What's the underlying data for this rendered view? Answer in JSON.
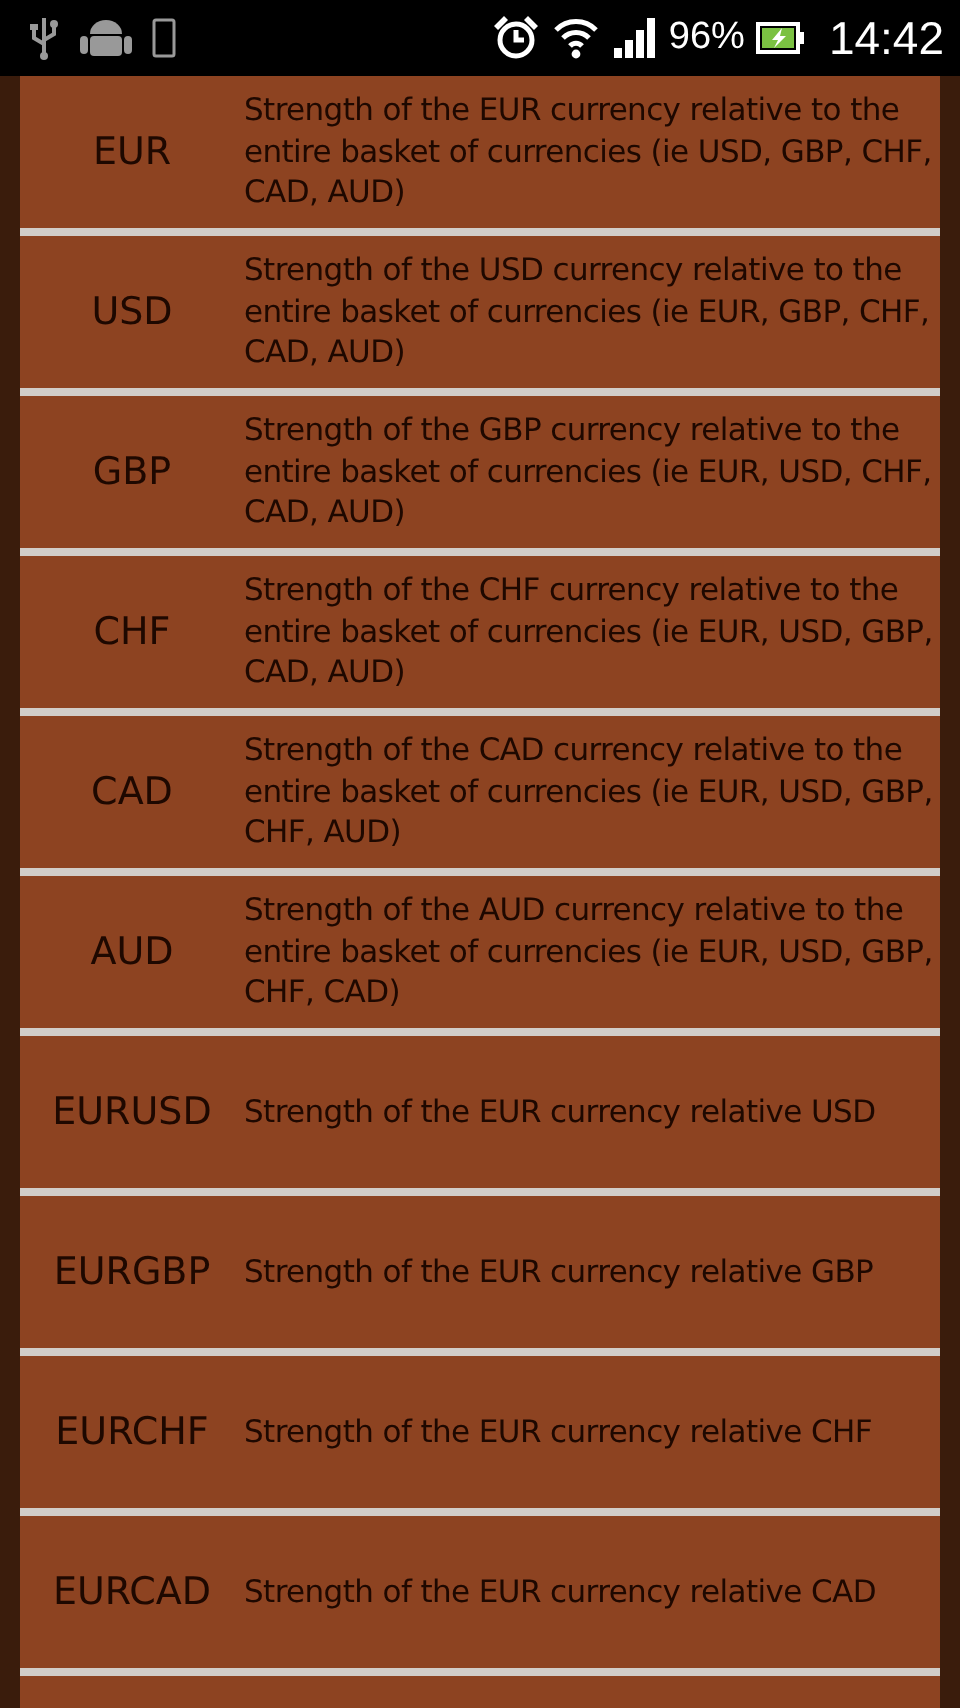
{
  "status_bar": {
    "battery_text": "96%",
    "time": "14:42"
  },
  "currencies": [
    {
      "code": "EUR",
      "description": "Strength of the EUR currency relative to the entire basket of currencies (ie USD, GBP, CHF, CAD, AUD)"
    },
    {
      "code": "USD",
      "description": "Strength of the USD currency relative to the entire basket of currencies (ie EUR, GBP, CHF, CAD, AUD)"
    },
    {
      "code": "GBP",
      "description": "Strength of the GBP currency relative to the entire basket of currencies (ie EUR, USD, CHF, CAD, AUD)"
    },
    {
      "code": "CHF",
      "description": "Strength of the CHF currency relative to the entire basket of currencies (ie EUR, USD, GBP, CAD, AUD)"
    },
    {
      "code": "CAD",
      "description": "Strength of the CAD currency relative to the entire basket of currencies (ie EUR, USD, GBP, CHF, AUD)"
    },
    {
      "code": "AUD",
      "description": "Strength of the AUD currency relative to the entire basket of currencies (ie EUR, USD, GBP, CHF, CAD)"
    },
    {
      "code": "EURUSD",
      "description": "Strength of the EUR currency relative USD"
    },
    {
      "code": "EURGBP",
      "description": "Strength of the EUR currency relative GBP"
    },
    {
      "code": "EURCHF",
      "description": "Strength of the EUR currency relative CHF"
    },
    {
      "code": "EURCAD",
      "description": "Strength of the EUR currency relative CAD"
    }
  ]
}
